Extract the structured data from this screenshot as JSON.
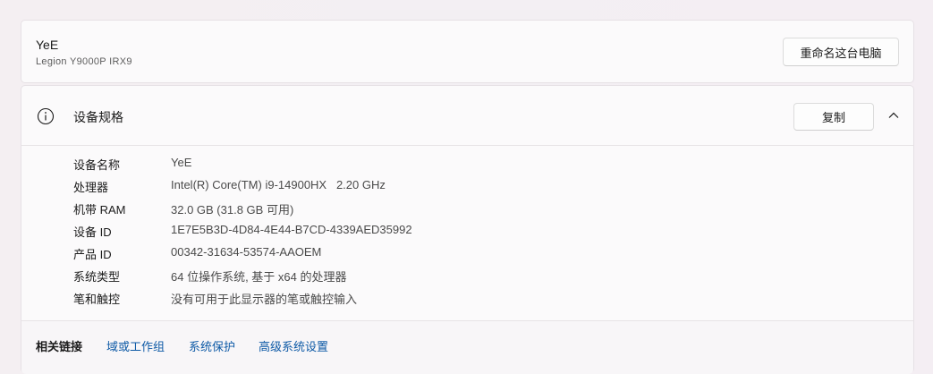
{
  "device": {
    "name": "YeE",
    "model": "Legion Y9000P IRX9",
    "rename_label": "重命名这台电脑"
  },
  "specs": {
    "title": "设备规格",
    "copy_label": "复制",
    "icons": {
      "info": "info-icon",
      "collapse": "chevron-up-icon"
    },
    "rows": [
      {
        "label": "设备名称",
        "value": "YeE"
      },
      {
        "label": "处理器",
        "value": "Intel(R) Core(TM) i9-14900HX   2.20 GHz"
      },
      {
        "label": "机带 RAM",
        "value": "32.0 GB (31.8 GB 可用)"
      },
      {
        "label": "设备 ID",
        "value": "1E7E5B3D-4D84-4E44-B7CD-4339AED35992"
      },
      {
        "label": "产品 ID",
        "value": "00342-31634-53574-AAOEM"
      },
      {
        "label": "系统类型",
        "value": "64 位操作系统, 基于 x64 的处理器"
      },
      {
        "label": "笔和触控",
        "value": "没有可用于此显示器的笔或触控输入"
      }
    ]
  },
  "related_links": {
    "title": "相关链接",
    "links": [
      {
        "label": "域或工作组"
      },
      {
        "label": "系统保护"
      },
      {
        "label": "高级系统设置"
      }
    ]
  },
  "colors": {
    "link": "#0e5aa6",
    "background": "#f3eef2",
    "card": "#fbfafb"
  }
}
